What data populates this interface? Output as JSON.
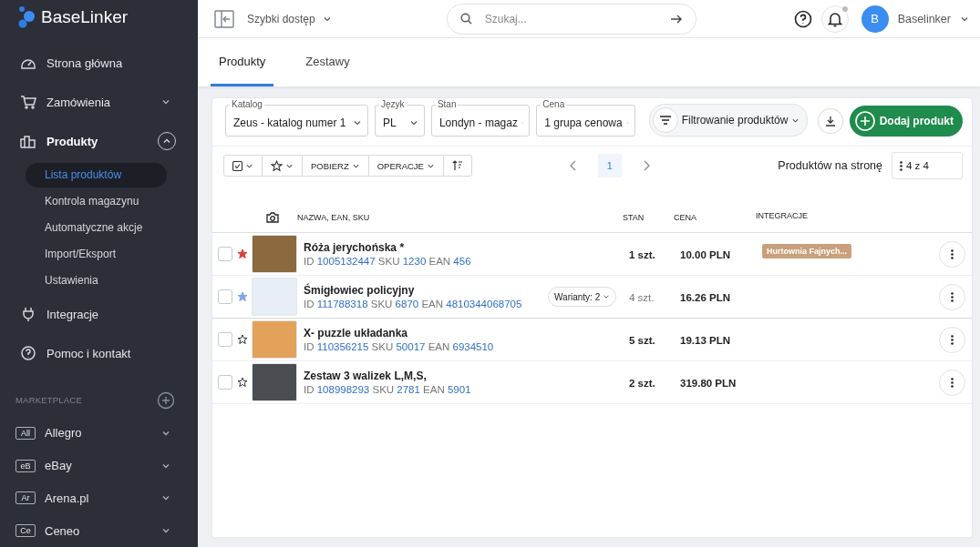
{
  "brand": {
    "name": "BaseLinker"
  },
  "sidebar": {
    "items": [
      {
        "label": "Strona główna",
        "chevron": false,
        "expanded": false
      },
      {
        "label": "Zamówienia",
        "chevron": true,
        "expanded": false
      },
      {
        "label": "Produkty",
        "chevron": true,
        "expanded": true,
        "children": [
          {
            "label": "Lista produktów",
            "selected": true
          },
          {
            "label": "Kontrola magazynu",
            "selected": false
          },
          {
            "label": "Automatyczne akcje",
            "selected": false
          },
          {
            "label": "Import/Eksport",
            "selected": false
          },
          {
            "label": "Ustawienia",
            "selected": false
          }
        ]
      },
      {
        "label": "Integracje",
        "chevron": false,
        "expanded": false
      },
      {
        "label": "Pomoc i kontakt",
        "chevron": false,
        "expanded": false
      }
    ],
    "section_title": "MARKETPLACE",
    "marketplaces": [
      {
        "badge": "All",
        "label": "Allegro"
      },
      {
        "badge": "eB",
        "label": "eBay"
      },
      {
        "badge": "Ar",
        "label": "Arena.pl"
      },
      {
        "badge": "Ce",
        "label": "Ceneo"
      }
    ]
  },
  "header": {
    "quick_access": "Szybki dostęp",
    "search": {
      "placeholder": "Szukaj..."
    },
    "notification_dot": true,
    "avatar": "B",
    "user": "Baselinker"
  },
  "tabs": [
    {
      "label": "Produkty",
      "selected": true
    },
    {
      "label": "Zestawy",
      "selected": false
    }
  ],
  "filters": [
    {
      "label": "Katalog",
      "value": "Zeus - katalog numer 1"
    },
    {
      "label": "Język",
      "value": "PL"
    },
    {
      "label": "Stan",
      "value": "Londyn - magaz"
    },
    {
      "label": "Cena",
      "value": "1 grupa cenowa"
    }
  ],
  "filter_button": "Filtrowanie produktów",
  "add_button": "Dodaj produkt",
  "toolbar": {
    "download": "POBIERZ",
    "operations": "OPERACJE",
    "page": "1",
    "per_page_label": "Produktów na stronę",
    "per_page": "4 z 4"
  },
  "table": {
    "columns": [
      "NAZWA, EAN, SKU",
      "STAN",
      "CENA",
      "INTEGRACJE"
    ],
    "rows": [
      {
        "checked": false,
        "name": "Róża jerychońska *",
        "codes": [
          {
            "label": "ID",
            "value": "1005132447"
          },
          {
            "label": "SKU",
            "value": "1230"
          },
          {
            "label": "EAN",
            "value": "456"
          }
        ],
        "star": {
          "filled": true,
          "color": "#d9413b"
        },
        "stock": "1 szt.",
        "stock_muted": false,
        "price": "10.00 PLN",
        "integration": "Hurtownia Fajnych..."
      },
      {
        "checked": false,
        "name": "Śmigłowiec policyjny",
        "codes": [
          {
            "label": "ID",
            "value": "111788318"
          },
          {
            "label": "SKU",
            "value": "6870"
          },
          {
            "label": "EAN",
            "value": "4810344068705"
          }
        ],
        "star": {
          "filled": true,
          "color": "#7ea7e2"
        },
        "variants": "Warianty: 2",
        "stock": "4 szt.",
        "stock_muted": true,
        "price": "16.26 PLN"
      },
      {
        "checked": false,
        "name": "X- puzzle układanka",
        "codes": [
          {
            "label": "ID",
            "value": "110356215"
          },
          {
            "label": "SKU",
            "value": "50017"
          },
          {
            "label": "EAN",
            "value": "6934510"
          }
        ],
        "star": {
          "filled": false
        },
        "stock": "5 szt.",
        "stock_muted": false,
        "price": "19.13 PLN"
      },
      {
        "checked": false,
        "name": "Zestaw 3 walizek L,M,S,",
        "codes": [
          {
            "label": "ID",
            "value": "108998293"
          },
          {
            "label": "SKU",
            "value": "2781"
          },
          {
            "label": "EAN",
            "value": "5901"
          }
        ],
        "star": {
          "filled": false
        },
        "stock": "2 szt.",
        "stock_muted": false,
        "price": "319.80 PLN"
      }
    ]
  }
}
